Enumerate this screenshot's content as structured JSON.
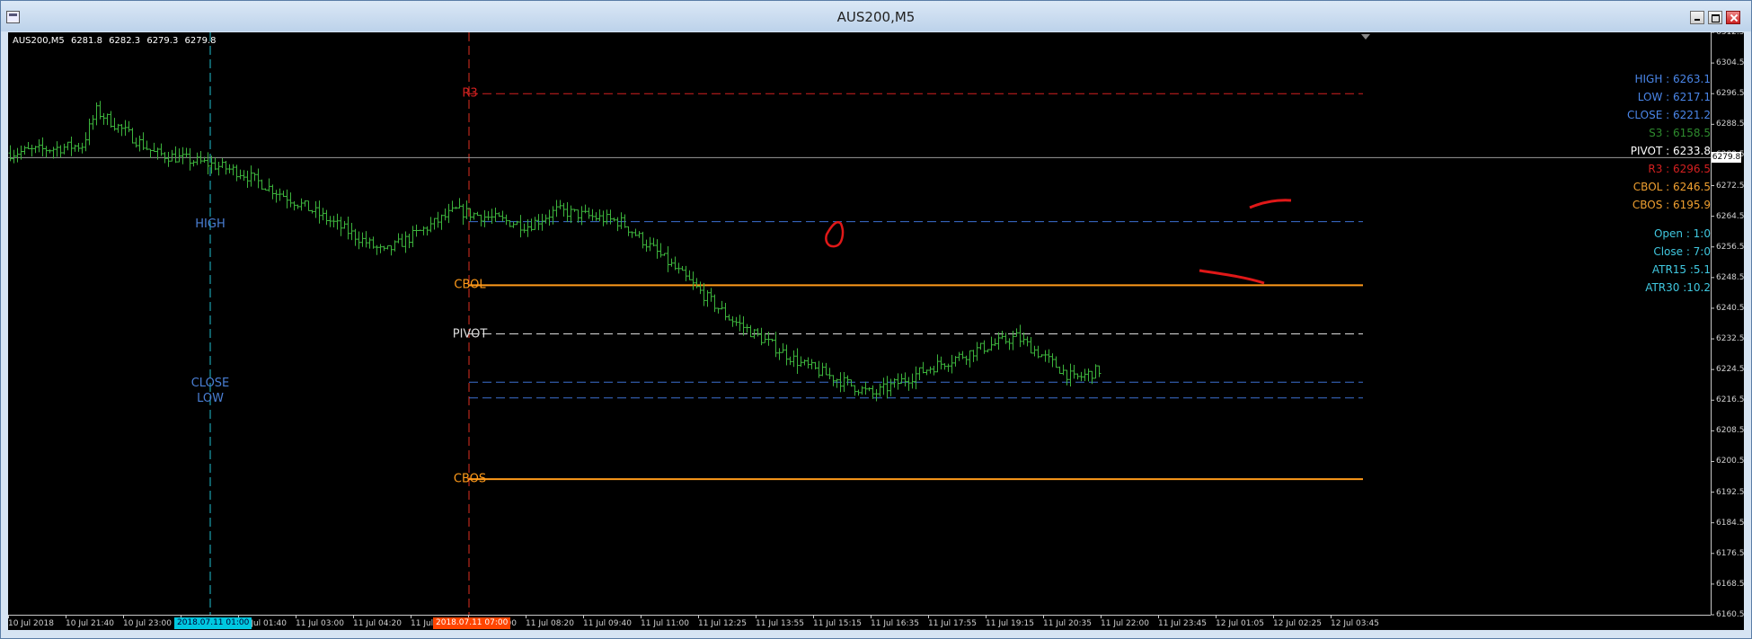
{
  "window": {
    "title": "AUS200,M5"
  },
  "symbol_info": {
    "symbol": "AUS200,M5",
    "open": "6281.8",
    "high": "6282.3",
    "low": "6279.3",
    "close": "6279.8"
  },
  "levels": {
    "r3": {
      "label": "R3",
      "value": 6296.5,
      "color": "#d42020"
    },
    "high": {
      "label": "HIGH",
      "value": 6263.1,
      "color": "#3c6fcf"
    },
    "cbol": {
      "label": "CBOL",
      "value": 6246.5,
      "color": "#ff9a1a"
    },
    "pivot": {
      "label": "PIVOT",
      "value": 6233.8,
      "color": "#dcdcdc"
    },
    "close": {
      "label": "CLOSE",
      "value": 6221.2,
      "color": "#3c6fcf"
    },
    "low": {
      "label": "LOW",
      "value": 6217.1,
      "color": "#3c6fcf"
    },
    "cbos": {
      "label": "CBOS",
      "value": 6195.9,
      "color": "#ff9a1a"
    }
  },
  "vlines": {
    "day_start": {
      "labels": [
        "HIGH",
        "CLOSE",
        "LOW"
      ],
      "color": "#20c0d0"
    },
    "session_start": {
      "color": "#e03020"
    }
  },
  "info_panel": [
    {
      "text": "HIGH : 6263.1",
      "color": "#4a86e8"
    },
    {
      "text": "LOW : 6217.1",
      "color": "#4a86e8"
    },
    {
      "text": "CLOSE : 6221.2",
      "color": "#4a86e8"
    },
    {
      "text": "S3 : 6158.5",
      "color": "#2e8b2e"
    },
    {
      "text": "PIVOT : 6233.8",
      "color": "#ffffff"
    },
    {
      "text": "R3 : 6296.5",
      "color": "#d42020"
    },
    {
      "text": "CBOL : 6246.5",
      "color": "#f0a030"
    },
    {
      "text": "CBOS : 6195.9",
      "color": "#f0a030"
    },
    {
      "text": "",
      "color": ""
    },
    {
      "text": "Open : 1:0",
      "color": "#40c8e0"
    },
    {
      "text": "Close : 7:0",
      "color": "#40c8e0"
    },
    {
      "text": "ATR15 :5.1",
      "color": "#40c8e0"
    },
    {
      "text": "ATR30 :10.2",
      "color": "#40c8e0"
    }
  ],
  "price_scale": {
    "min": 6160.5,
    "max": 6312.5,
    "step": 8,
    "current": 6279.8,
    "current_label": "6279.8"
  },
  "time_axis": {
    "ticks": [
      "10 Jul 2018",
      "10 Jul 21:40",
      "10 Jul 23:00",
      "11 Jul 00:20",
      "11 Jul 01:40",
      "11 Jul 03:00",
      "11 Jul 04:20",
      "11 Jul 05:40",
      "11 Jul 07:00",
      "11 Jul 08:20",
      "11 Jul 09:40",
      "11 Jul 11:00",
      "11 Jul 12:25",
      "11 Jul 13:55",
      "11 Jul 15:15",
      "11 Jul 16:35",
      "11 Jul 17:55",
      "11 Jul 19:15",
      "11 Jul 20:35",
      "11 Jul 22:00",
      "11 Jul 23:45",
      "12 Jul 01:05",
      "12 Jul 02:25",
      "12 Jul 03:45"
    ],
    "marker_a": "2018.07.11 01:00",
    "marker_b": "2018.07.11 07:00"
  },
  "chart_data": {
    "type": "ohlc",
    "symbol": "AUS200",
    "timeframe": "M5",
    "color": "#3cb33c",
    "ylim": [
      6160.5,
      6312.5
    ],
    "x_start": "10 Jul 2018 20:20",
    "bar_minutes": 5,
    "path_points": [
      [
        0,
        6281
      ],
      [
        20,
        6283
      ],
      [
        24,
        6292
      ],
      [
        40,
        6281
      ],
      [
        56,
        6278
      ],
      [
        64,
        6276
      ],
      [
        84,
        6266
      ],
      [
        104,
        6255
      ],
      [
        124,
        6266
      ],
      [
        144,
        6262
      ],
      [
        152,
        6266
      ],
      [
        170,
        6263
      ],
      [
        180,
        6255
      ],
      [
        200,
        6238
      ],
      [
        220,
        6226
      ],
      [
        240,
        6218
      ],
      [
        256,
        6225
      ],
      [
        270,
        6230
      ],
      [
        280,
        6233
      ],
      [
        296,
        6222
      ],
      [
        320,
        6230
      ],
      [
        340,
        6233
      ],
      [
        360,
        6229
      ],
      [
        380,
        6226
      ],
      [
        400,
        6224
      ],
      [
        424,
        6223
      ],
      [
        440,
        6222
      ],
      [
        460,
        6219
      ],
      [
        480,
        6224
      ],
      [
        500,
        6220
      ],
      [
        520,
        6222
      ],
      [
        540,
        6224
      ],
      [
        560,
        6228
      ],
      [
        580,
        6234
      ],
      [
        600,
        6234
      ],
      [
        620,
        6234
      ],
      [
        640,
        6240
      ],
      [
        656,
        6236
      ],
      [
        672,
        6238
      ],
      [
        690,
        6240
      ],
      [
        704,
        6244
      ],
      [
        720,
        6240
      ],
      [
        740,
        6242
      ],
      [
        760,
        6230
      ],
      [
        780,
        6226
      ],
      [
        800,
        6228
      ],
      [
        820,
        6222
      ],
      [
        840,
        6218
      ],
      [
        856,
        6214
      ],
      [
        872,
        6222
      ],
      [
        892,
        6220
      ],
      [
        912,
        6220
      ],
      [
        932,
        6218
      ],
      [
        952,
        6222
      ],
      [
        972,
        6222
      ],
      [
        992,
        6220
      ],
      [
        1012,
        6222
      ],
      [
        1032,
        6222
      ],
      [
        1052,
        6222
      ],
      [
        1064,
        6219
      ],
      [
        1076,
        6246
      ],
      [
        1090,
        6248
      ],
      [
        1100,
        6252
      ],
      [
        1110,
        6258
      ],
      [
        1120,
        6264
      ],
      [
        1136,
        6268
      ],
      [
        1148,
        6269
      ],
      [
        1164,
        6274
      ],
      [
        1180,
        6278
      ],
      [
        1196,
        6283
      ],
      [
        1208,
        6280
      ]
    ],
    "bars_total": 303,
    "annotations": [
      "red circle at 11 Jul ~15:15 high near CBOL",
      "red strokes at breakout near 12 Jul 00:00 and 01:05"
    ]
  }
}
